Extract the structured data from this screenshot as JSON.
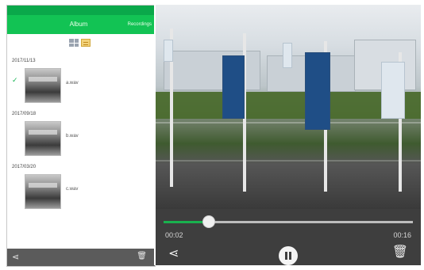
{
  "left": {
    "status_left": "",
    "status_right": "",
    "title": "Album",
    "action": "Recordings",
    "groups": [
      {
        "date": "2017/11/13",
        "item_name": "a.wav",
        "checked": true
      },
      {
        "date": "2017/09/18",
        "item_name": "b.wav",
        "checked": false
      },
      {
        "date": "2017/03/20",
        "item_name": "c.wav",
        "checked": false
      }
    ]
  },
  "right": {
    "video_timestamp_top": "",
    "watermark": "",
    "time_current": "00:02",
    "time_total": "00:16",
    "progress": 0.18
  },
  "colors": {
    "brand_green": "#12c354",
    "progress_green": "#19b14e",
    "player_bg": "#3e3e3e"
  },
  "icons": {
    "share": "share-icon",
    "trash": "trash-icon",
    "pause": "pause-icon",
    "grid": "grid-icon",
    "list": "list-icon",
    "check": "check-icon"
  }
}
